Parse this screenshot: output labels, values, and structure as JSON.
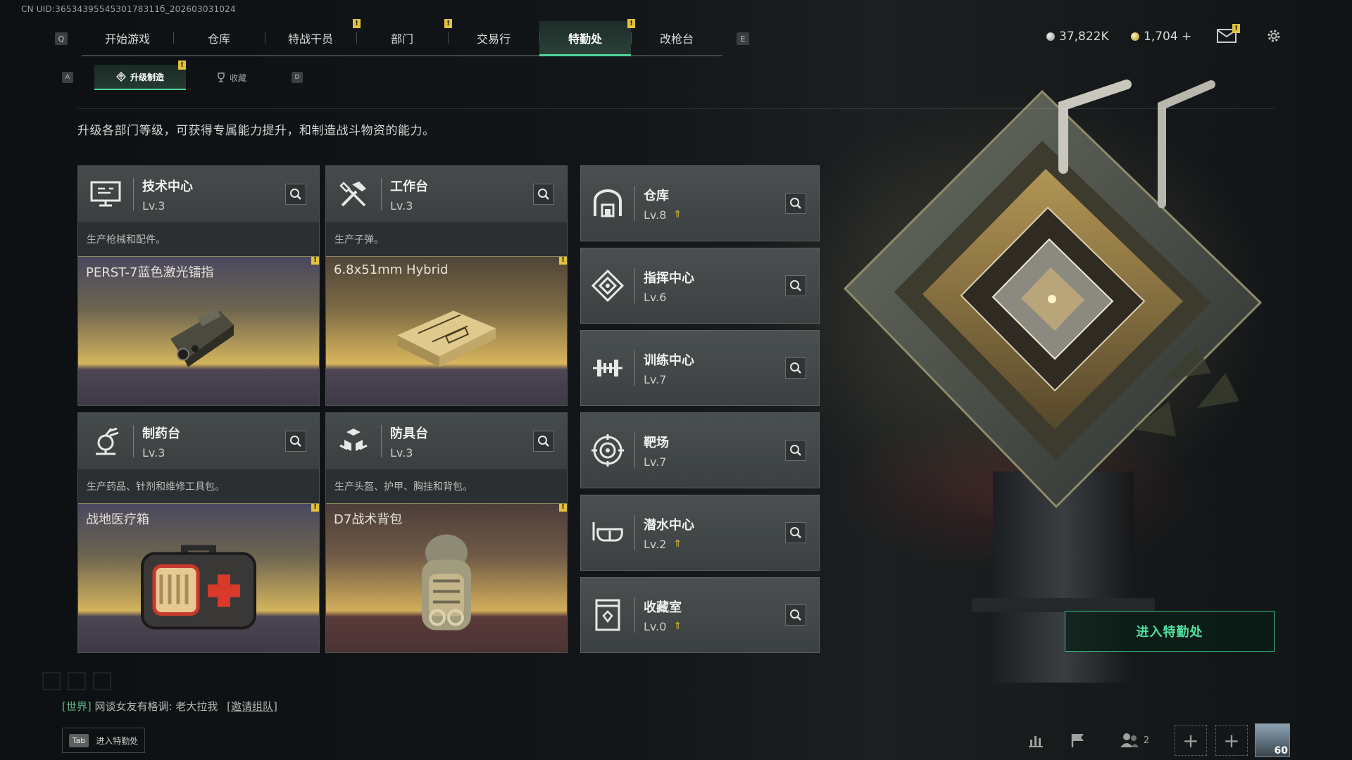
{
  "uid": "CN UID:3653439554530178311б_202603031024",
  "nav": {
    "key_left": "Q",
    "key_right": "E",
    "tabs": [
      {
        "label": "开始游戏",
        "badge": false
      },
      {
        "label": "仓库",
        "badge": false
      },
      {
        "label": "特战干员",
        "badge": true
      },
      {
        "label": "部门",
        "badge": true
      },
      {
        "label": "交易行",
        "badge": false
      },
      {
        "label": "特勤处",
        "badge": true,
        "active": true
      },
      {
        "label": "改枪台",
        "badge": false
      }
    ],
    "badge_symbol": "!"
  },
  "currency": {
    "silver": "37,822K",
    "gold": "1,704 +"
  },
  "subnav": {
    "key_left": "A",
    "key_right": "D",
    "tabs": [
      {
        "label": "升级制造",
        "active": true,
        "badge": true
      },
      {
        "label": "收藏",
        "active": false,
        "badge": false
      }
    ]
  },
  "description": "升级各部门等级，可获得专属能力提升，和制造战斗物资的能力。",
  "production_cards": [
    {
      "name": "技术中心",
      "level": "Lv.3",
      "sub": "生产枪械和配件。",
      "item": "PERST-7蓝色激光镭指",
      "icon": "tech-center-icon"
    },
    {
      "name": "工作台",
      "level": "Lv.3",
      "sub": "生产子弹。",
      "item": "6.8x51mm Hybrid",
      "icon": "workbench-icon"
    },
    {
      "name": "制药台",
      "level": "Lv.3",
      "sub": "生产药品、针剂和维修工具包。",
      "item": "战地医疗箱",
      "icon": "pharmacy-icon"
    },
    {
      "name": "防具台",
      "level": "Lv.3",
      "sub": "生产头盔、护甲、胸挂和背包。",
      "item": "D7战术背包",
      "icon": "armor-bench-icon"
    }
  ],
  "side_cards": [
    {
      "name": "仓库",
      "level": "Lv.8",
      "upgradable": true,
      "icon": "warehouse-icon"
    },
    {
      "name": "指挥中心",
      "level": "Lv.6",
      "upgradable": false,
      "icon": "command-center-icon"
    },
    {
      "name": "训练中心",
      "level": "Lv.7",
      "upgradable": false,
      "icon": "training-center-icon"
    },
    {
      "name": "靶场",
      "level": "Lv.7",
      "upgradable": false,
      "icon": "shooting-range-icon"
    },
    {
      "name": "潜水中心",
      "level": "Lv.2",
      "upgradable": true,
      "icon": "diving-center-icon"
    },
    {
      "name": "收藏室",
      "level": "Lv.0",
      "upgradable": true,
      "icon": "collection-room-icon"
    }
  ],
  "enter_button": "进入特勤处",
  "chat": {
    "channel": "[世界]",
    "message": "网谈女友有格调: 老大拉我",
    "invite": "[邀请组队]"
  },
  "tab_hint": {
    "key": "Tab",
    "label": "进入特勤处"
  },
  "friends_count": "2",
  "player_level": "60",
  "colors": {
    "accent": "#4fd59a",
    "badge": "#e3c23b",
    "upgrade_arrow": "#e3c23b"
  }
}
